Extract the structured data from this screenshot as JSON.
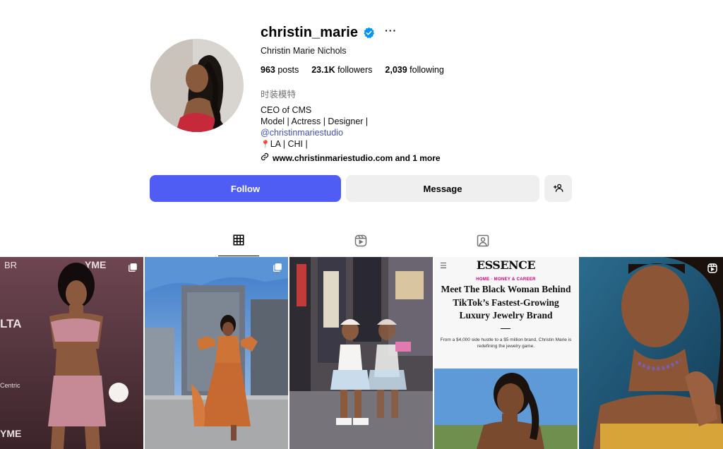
{
  "profile": {
    "username": "christin_marie",
    "full_name": "Christin Marie Nichols",
    "more_label": "···"
  },
  "stats": {
    "posts_count": "963",
    "posts_label": "posts",
    "followers_count": "23.1K",
    "followers_label": "followers",
    "following_count": "2,039",
    "following_label": "following"
  },
  "bio": {
    "category": "时装模特",
    "lines": [
      "CEO of CMS",
      "Model | Actress | Designer |"
    ],
    "mention": "@christinmariestudio",
    "location": "LA | CHI |",
    "link": "www.christinmariestudio.com and 1 more"
  },
  "actions": {
    "follow_label": "Follow",
    "message_label": "Message"
  },
  "tabs": [
    {
      "icon": "grid-icon",
      "active": true
    },
    {
      "icon": "reels-icon",
      "active": false
    },
    {
      "icon": "tagged-icon",
      "active": false
    }
  ],
  "posts": [
    {
      "type": "carousel",
      "icon": "carousel-icon",
      "overlay_texts": [
        "BR",
        "YME",
        "LTA",
        "Centric",
        "YME"
      ]
    },
    {
      "type": "carousel",
      "icon": "carousel-icon"
    },
    {
      "type": "image"
    },
    {
      "type": "image",
      "magazine": {
        "logo": "ESSENCE",
        "kicker": "HOME · MONEY & CAREER",
        "headline": "Meet The Black Woman Behind TikTok’s Fastest-Growing Luxury Jewelry Brand",
        "subhead": "From a $4,000 side hustle to a $5 million brand, Christin Marie is redefining the jewelry game."
      }
    },
    {
      "type": "reel",
      "icon": "reel-icon"
    }
  ],
  "colors": {
    "follow_button": "#4f5df5",
    "secondary_button": "#efefef",
    "verified_badge": "#0095f6",
    "mention_link": "#4150b8"
  }
}
